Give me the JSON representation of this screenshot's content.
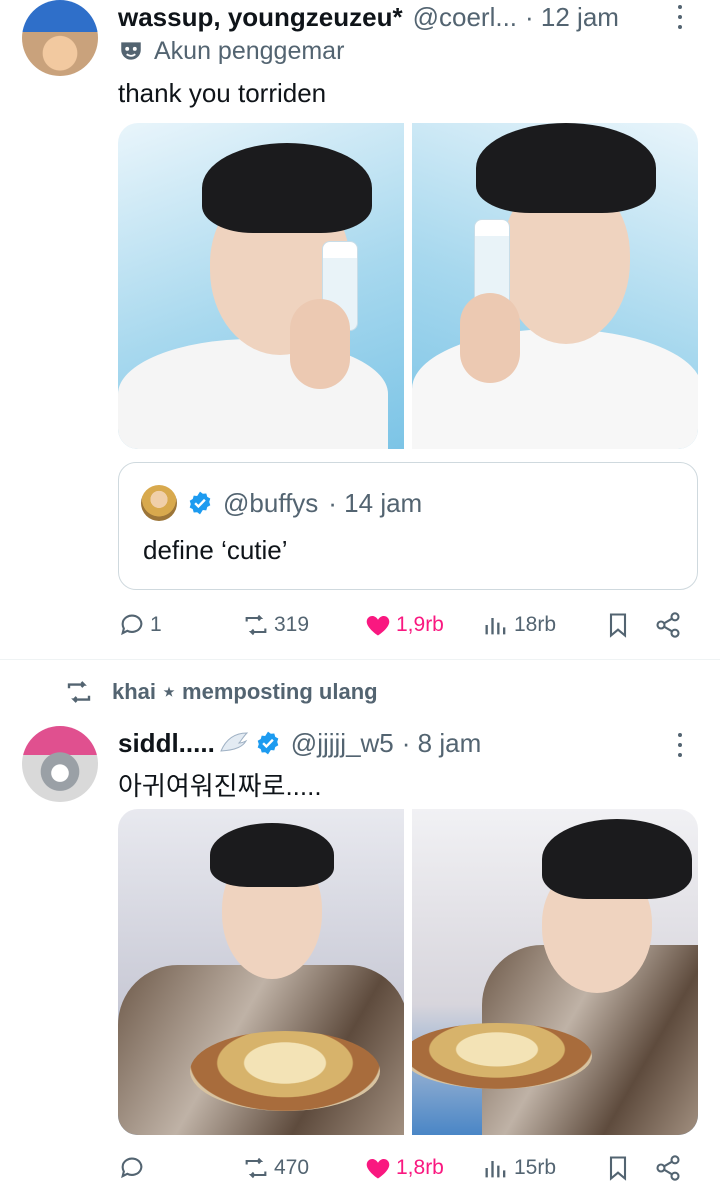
{
  "posts": [
    {
      "display_name": "wassup, youngzeuzeu*",
      "handle": "@coerl...",
      "time": "· 12 jam",
      "badge_label": "Akun penggemar",
      "text": "thank you torriden",
      "quote": {
        "handle": "@buffys",
        "time": "· 14 jam",
        "text": "define ‘cutie’"
      },
      "stats": {
        "replies": "1",
        "reposts": "319",
        "likes": "1,9rb",
        "views": "18rb"
      }
    },
    {
      "repost_by": "khai ⋆ memposting ulang",
      "display_name": "siddl.....",
      "handle": "@jjjjj_w5",
      "time": "· 8 jam",
      "text": "아귀여워진짜로.....",
      "stats": {
        "replies": "",
        "reposts": "470",
        "likes": "1,8rb",
        "views": "15rb"
      }
    }
  ],
  "icons": {
    "reply": "reply-icon",
    "repost": "repost-icon",
    "like": "heart-icon",
    "views": "views-icon",
    "bookmark": "bookmark-icon",
    "share": "share-icon",
    "fan": "mask-icon",
    "verified": "verified-badge-icon",
    "more": "more-icon"
  },
  "colors": {
    "like_active": "#f91880",
    "verified": "#1d9bf0",
    "secondary_text": "#536471",
    "border": "#cfd9de"
  }
}
